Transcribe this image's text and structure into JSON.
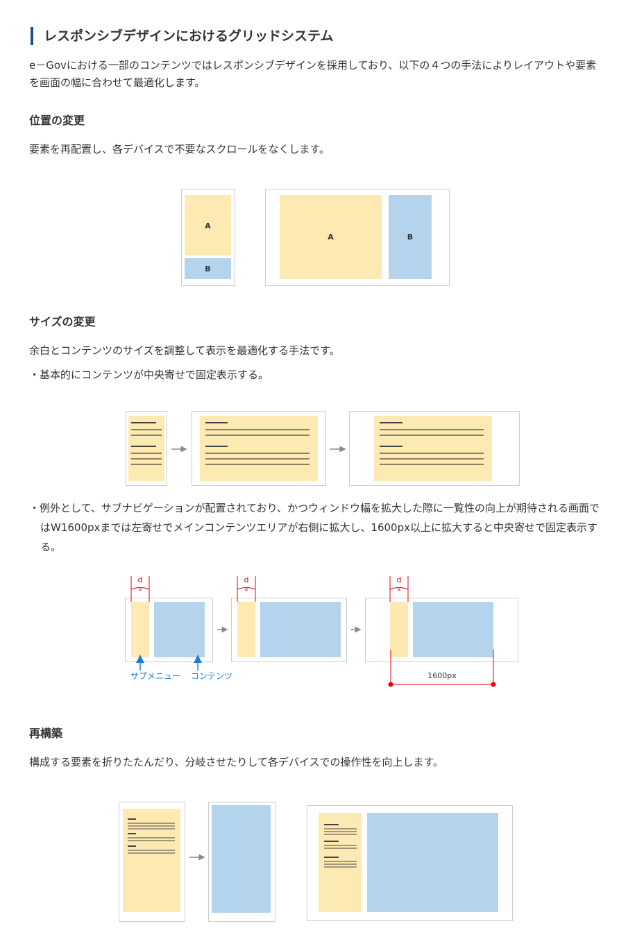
{
  "title": "レスポンシブデザインにおけるグリッドシステム",
  "intro": "e－Govにおける一部のコンテンツではレスポンシブデザインを採用しており、以下の４つの手法によりレイアウトや要素を画面の幅に合わせて最適化します。",
  "sections": {
    "position": {
      "heading": "位置の変更",
      "description": "要素を再配置し、各デバイスで不要なスクロールをなくします。",
      "label_a": "A",
      "label_b": "B"
    },
    "size": {
      "heading": "サイズの変更",
      "description": "余白とコンテンツのサイズを調整して表示を最適化する手法です。",
      "bullet1": "・基本的にコンテンツが中央寄せで固定表示する。",
      "bullet2": "・例外として、サブナビゲーションが配置されており、かつウィンドウ幅を拡大した際に一覧性の向上が期待される画面ではW1600pxまでは左寄せでメインコンテンツエリアが右側に拡大し、1600px以上に拡大すると中央寄せで固定表示する。",
      "d_label": "d",
      "submenu_label": "サブメニュー",
      "contents_label": "コンテンツ",
      "width_label": "1600px"
    },
    "rebuild": {
      "heading": "再構築",
      "description": "構成する要素を折りたたんだり、分岐させたりして各デバイスでの操作性を向上します。"
    }
  },
  "colors": {
    "accent": "#1d4f91",
    "yellow": "#fdeab2",
    "blue": "#b3d4ec",
    "red": "#e60012",
    "label_blue": "#1a7fd4",
    "frame": "#cccccc",
    "arrow": "#888888"
  }
}
